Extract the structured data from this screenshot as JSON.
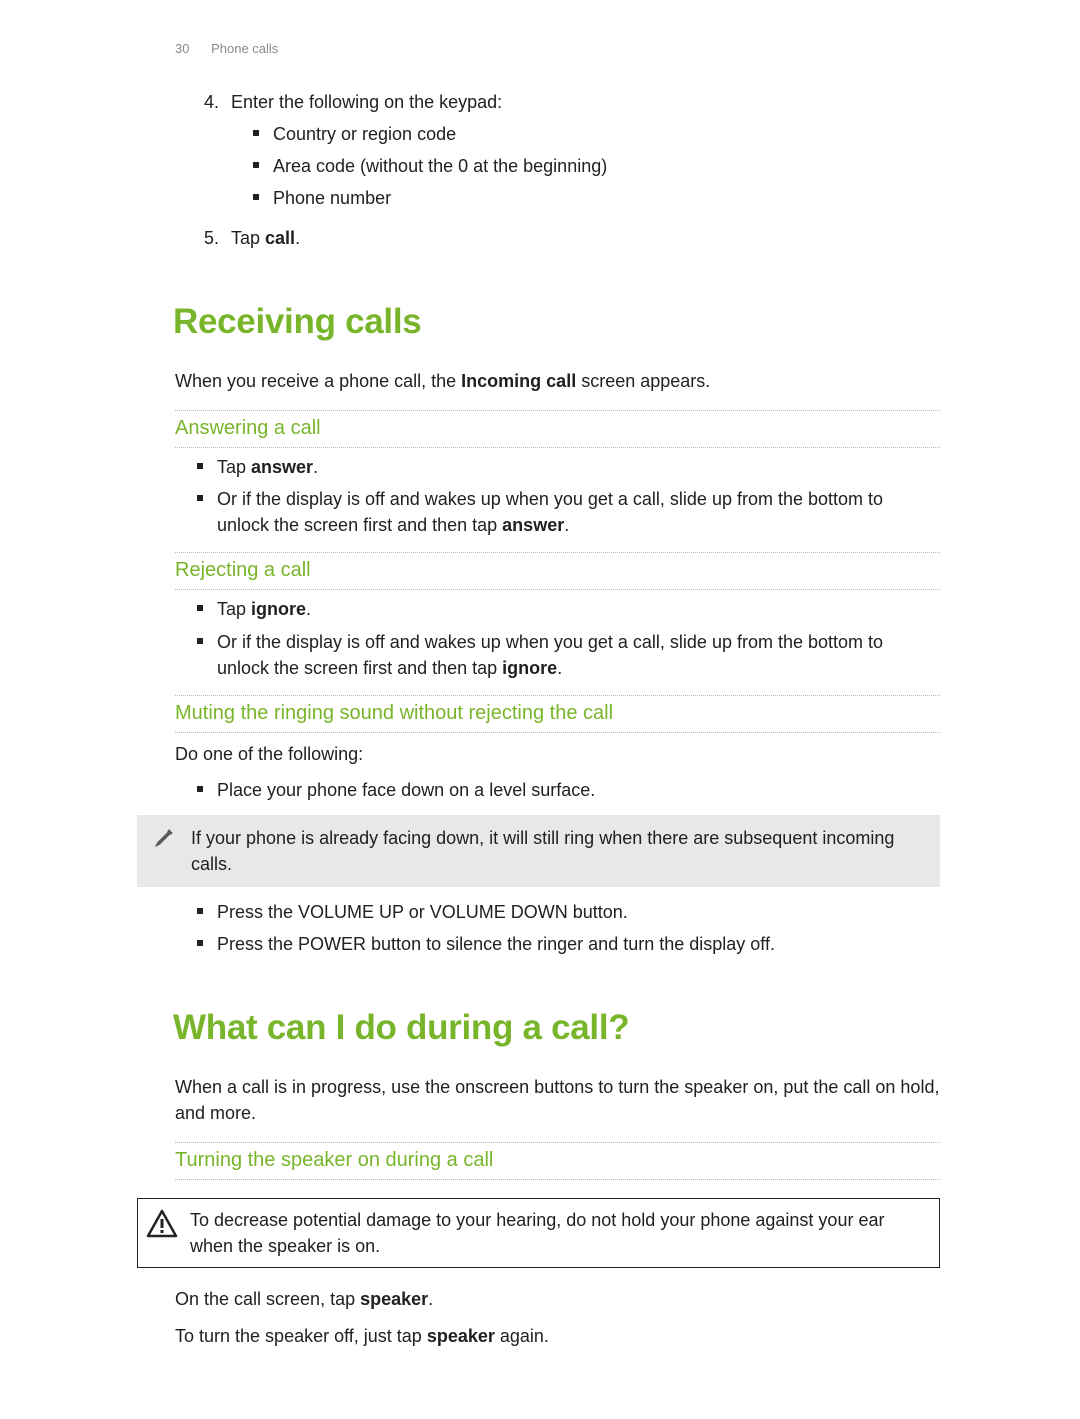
{
  "header": {
    "page_number": "30",
    "section": "Phone calls"
  },
  "intro_steps": {
    "step4": {
      "number": "4.",
      "text": "Enter the following on the keypad:",
      "bullets": [
        "Country or region code",
        "Area code (without the 0 at the beginning)",
        "Phone number"
      ]
    },
    "step5": {
      "number": "5.",
      "text_before": "Tap ",
      "bold": "call",
      "text_after": "."
    }
  },
  "receiving": {
    "title": "Receiving calls",
    "intro_before": "When you receive a phone call, the ",
    "intro_bold": "Incoming call",
    "intro_after": " screen appears.",
    "answering": {
      "title": "Answering a call",
      "b1_before": "Tap ",
      "b1_bold": "answer",
      "b1_after": ".",
      "b2_before": "Or if the display is off and wakes up when you get a call, slide up from the bottom to unlock the screen first and then tap ",
      "b2_bold": "answer",
      "b2_after": "."
    },
    "rejecting": {
      "title": "Rejecting a call",
      "b1_before": "Tap ",
      "b1_bold": "ignore",
      "b1_after": ".",
      "b2_before": "Or if the display is off and wakes up when you get a call, slide up from the bottom to unlock the screen first and then tap ",
      "b2_bold": "ignore",
      "b2_after": "."
    },
    "muting": {
      "title": "Muting the ringing sound without rejecting the call",
      "lead": "Do one of the following:",
      "b1": "Place your phone face down on a level surface.",
      "note": "If your phone is already facing down, it will still ring when there are subsequent incoming calls.",
      "b2": "Press the VOLUME UP or VOLUME DOWN button.",
      "b3": "Press the POWER button to silence the ringer and turn the display off."
    }
  },
  "during_call": {
    "title": "What can I do during a call?",
    "intro": "When a call is in progress, use the onscreen buttons to turn the speaker on, put the call on hold, and more.",
    "speaker": {
      "title": "Turning the speaker on during a call",
      "warning": "To decrease potential damage to your hearing, do not hold your phone against your ear when the speaker is on.",
      "p1_before": "On the call screen, tap ",
      "p1_bold": "speaker",
      "p1_after": ".",
      "p2_before": "To turn the speaker off, just tap ",
      "p2_bold": "speaker",
      "p2_after": " again."
    }
  }
}
